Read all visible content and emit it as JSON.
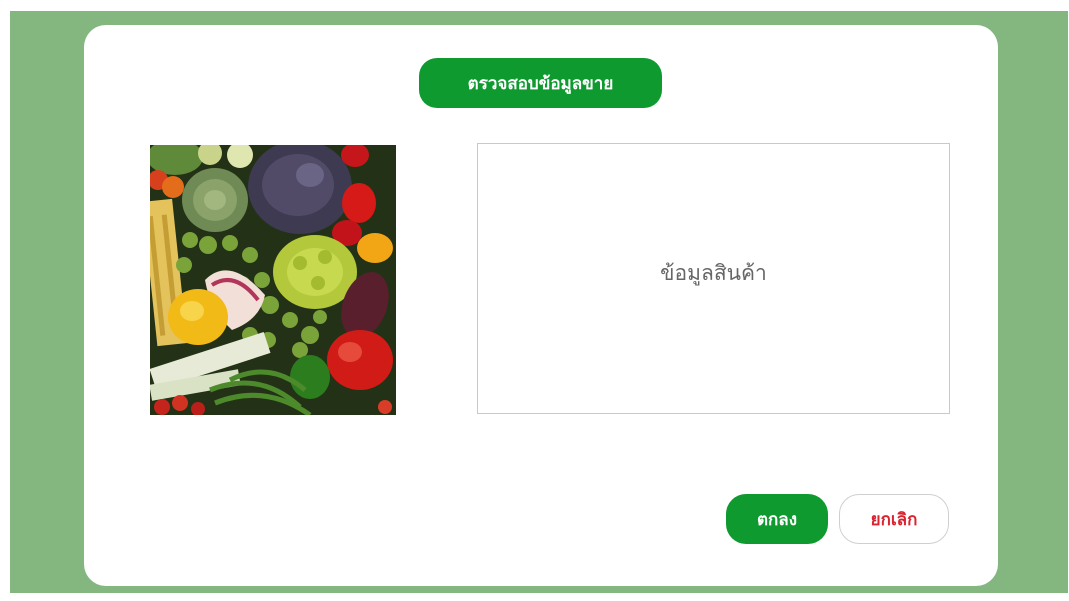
{
  "dialog": {
    "title": "ตรวจสอบข้อมูลขาย",
    "product_info_label": "ข้อมูลสินค้า",
    "confirm_label": "ตกลง",
    "cancel_label": "ยกเลิก"
  },
  "colors": {
    "backdrop": "#83b77f",
    "primary": "#0f9a30",
    "cancel_text": "#d9232f"
  }
}
